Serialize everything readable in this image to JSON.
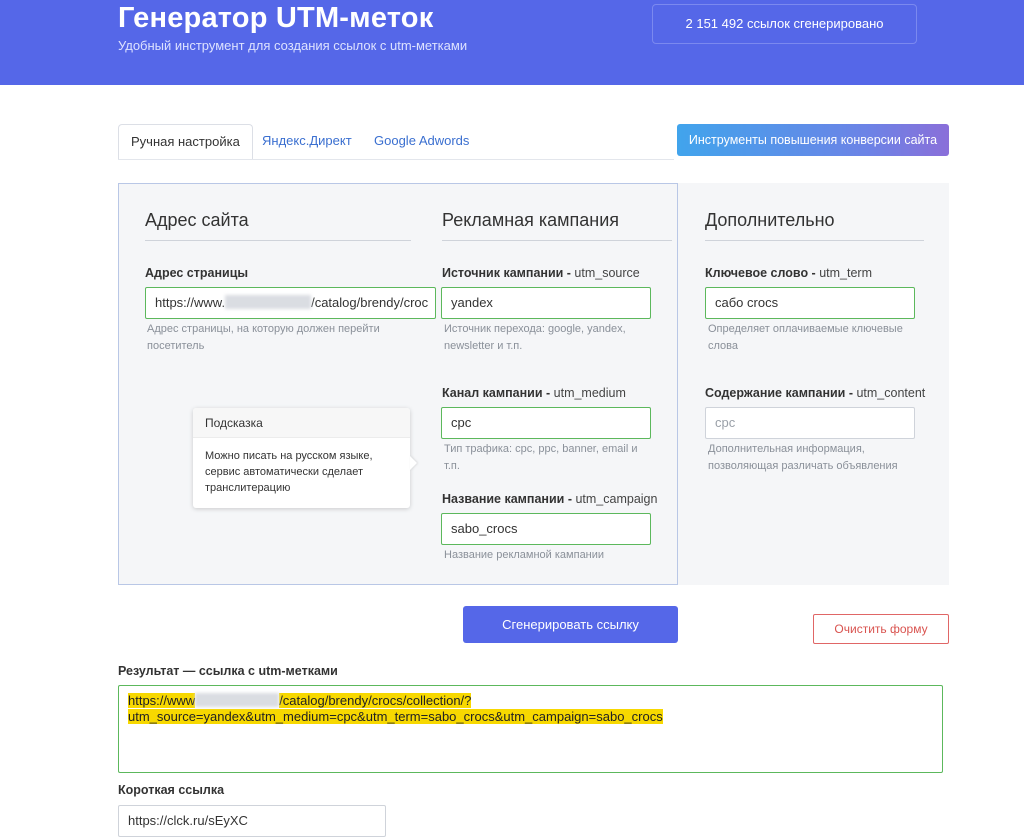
{
  "header": {
    "title": "Генератор UTM-меток",
    "subtitle": "Удобный инструмент для создания ссылок с utm-метками",
    "counter": "2 151 492 ссылок сгенерировано"
  },
  "tabs": [
    {
      "label": "Ручная настройка",
      "active": true
    },
    {
      "label": "Яндекс.Директ",
      "active": false
    },
    {
      "label": "Google Adwords",
      "active": false
    }
  ],
  "cro_button": "Инструменты повышения конверсии сайта",
  "sections": {
    "site": {
      "title": "Адрес сайта",
      "page_label": "Адрес страницы",
      "page_value_prefix": "https://www.",
      "page_value_suffix": "/catalog/brendy/croc",
      "page_hint": "Адрес страницы, на которую должен перейти посетитель"
    },
    "campaign": {
      "title": "Рекламная кампания",
      "source_label": "Источник кампании - ",
      "source_param": "utm_source",
      "source_value": "yandex",
      "source_hint": "Источник перехода: google, yandex, newsletter и т.п.",
      "medium_label": "Канал кампании - ",
      "medium_param": "utm_medium",
      "medium_value": "cpc",
      "medium_hint": "Тип трафика: cpc, ppc, banner, email и т.п.",
      "name_label": "Название кампании - ",
      "name_param": "utm_campaign",
      "name_value": "sabo_crocs",
      "name_hint": "Название рекламной кампании"
    },
    "extra": {
      "title": "Дополнительно",
      "term_label": "Ключевое слово - ",
      "term_param": "utm_term",
      "term_value": "сабо crocs",
      "term_hint": "Определяет оплачиваемые ключевые слова",
      "content_label": "Содержание кампании - ",
      "content_param": "utm_content",
      "content_placeholder": "cpc",
      "content_hint": "Дополнительная информация, позволяющая различать объявления"
    }
  },
  "tooltip": {
    "title": "Подсказка",
    "text": "Можно писать на русском языке, сервис автоматически сделает транслитерацию"
  },
  "actions": {
    "generate": "Сгенерировать ссылку",
    "clear": "Очистить форму"
  },
  "result": {
    "label": "Результат — ссылка с utm-метками",
    "line1_prefix": "https://www",
    "line1_suffix": "/catalog/brendy/crocs/collection/?",
    "line2": "utm_source=yandex&utm_medium=cpc&utm_term=sabo_crocs&utm_campaign=sabo_crocs"
  },
  "short_link": {
    "label": "Короткая ссылка",
    "value": "https://clck.ru/sEyXC"
  },
  "colors": {
    "brand": "#5567e8",
    "valid_border": "#5cb85c",
    "danger": "#d9534f",
    "highlight": "#f7d800"
  }
}
